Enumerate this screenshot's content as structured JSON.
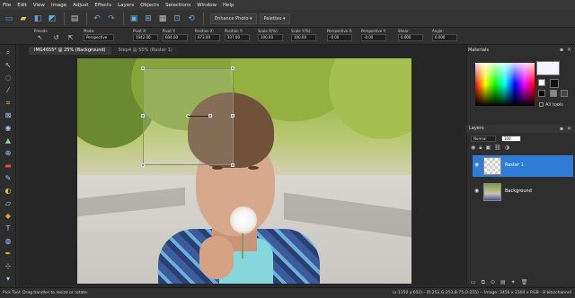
{
  "menubar": {
    "items": [
      "File",
      "Edit",
      "View",
      "Image",
      "Adjust",
      "Effects",
      "Layers",
      "Objects",
      "Selections",
      "Window",
      "Help"
    ]
  },
  "stdbar": {
    "icons": [
      "new-icon",
      "open-icon",
      "save-icon",
      "reopen-icon",
      "print-icon",
      "undo-icon",
      "redo-icon",
      "fit-icon",
      "zoom-icon",
      "grid-icon",
      "crop-icon",
      "refresh-icon"
    ],
    "enhance_label": "Enhance Photo ▾",
    "palettes_label": "Palettes ▾"
  },
  "options": {
    "presets_label": "Presets",
    "mode_label": "Mode:",
    "mode_value": "Perspective",
    "pivot_x_label": "Pivot X:",
    "pivot_x_value": "1042.00",
    "pivot_y_label": "Pivot Y:",
    "pivot_y_value": "604.00",
    "position_x_label": "Position X:",
    "position_x_value": "673.00",
    "position_y_label": "Position Y:",
    "position_y_value": "337.00",
    "scale_x_label": "Scale X(%):",
    "scale_x_value": "100.00",
    "scale_y_label": "Scale Y(%):",
    "scale_y_value": "100.00",
    "persp_x_label": "Perspective X:",
    "persp_x_value": "-0.00",
    "persp_y_label": "Perspective Y:",
    "persp_y_value": "-0.00",
    "shear_label": "Shear:",
    "shear_value": "0.000",
    "angle_label": "Angle:",
    "angle_value": "0.000"
  },
  "tabs": [
    {
      "label": "IMG4655* @ 25% (Background)"
    },
    {
      "label": "Step4 @ 50% (Raster 1)"
    }
  ],
  "materials": {
    "title": "Materials",
    "fg_color": "#f5f3ff",
    "bg_color": "#111111",
    "all_tools_label": "All tools"
  },
  "layers": {
    "title": "Layers",
    "blend_mode": "Normal",
    "opacity": "100",
    "items": [
      {
        "name": "Raster 1",
        "selected": true
      },
      {
        "name": "Background",
        "selected": false
      }
    ]
  },
  "status": {
    "left": "Pick Tool: Drag handles to resize or rotate.",
    "right": "(x:1150 y:602) - (R:252,G:253,B:75,O:255) -- Image: 3456 x 2304 x RGB - 8 bits/channel"
  }
}
